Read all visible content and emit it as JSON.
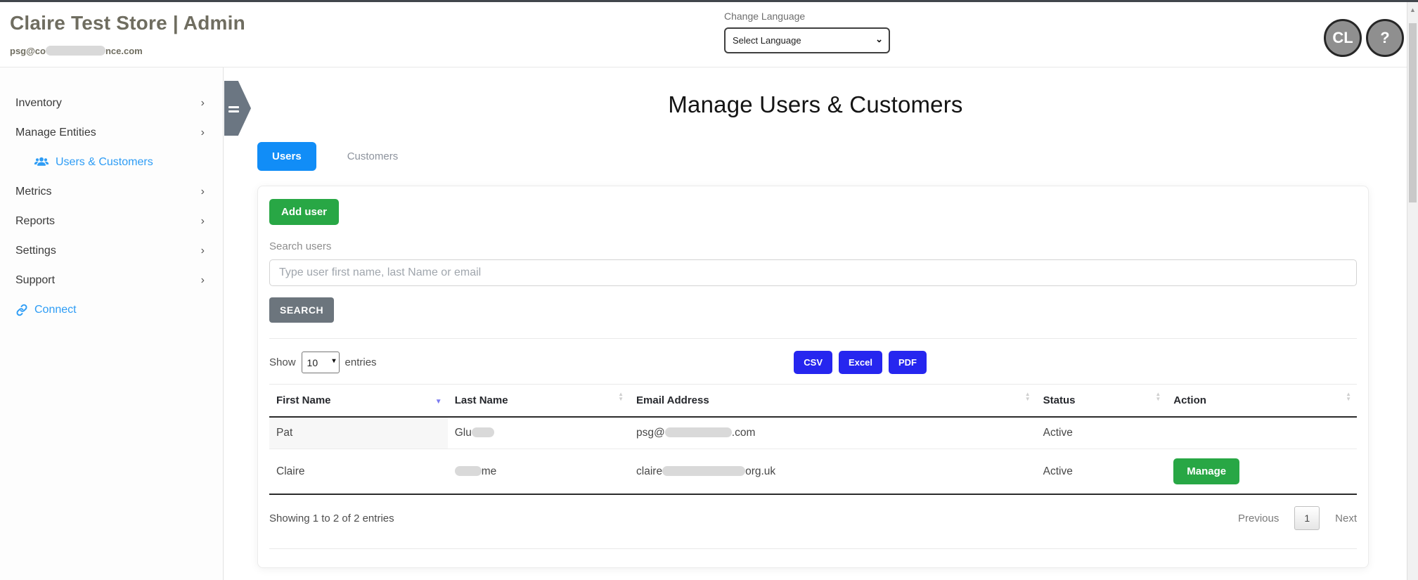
{
  "colors": {
    "accent_blue": "#118df7",
    "link_blue": "#2d9cf5",
    "export_blue": "#2626ef",
    "success_green": "#28a745",
    "secondary_gray": "#6c757d",
    "brand_text": "#6f6d60"
  },
  "header": {
    "brand": "Claire Test Store | Admin",
    "email_prefix": "psg@co",
    "email_suffix": "nce.com",
    "language_label": "Change Language",
    "language_value": "Select Language",
    "avatar_initials": "CL",
    "help": "?"
  },
  "sidebar": {
    "chevron": "›",
    "items": [
      {
        "label": "Inventory"
      },
      {
        "label": "Manage Entities"
      },
      {
        "label": "Users & Customers"
      },
      {
        "label": "Metrics"
      },
      {
        "label": "Reports"
      },
      {
        "label": "Settings"
      },
      {
        "label": "Support"
      },
      {
        "label": "Connect"
      }
    ]
  },
  "main": {
    "title": "Manage Users & Customers",
    "tabs": {
      "users": "Users",
      "customers": "Customers"
    },
    "add_user_label": "Add user",
    "search": {
      "label": "Search users",
      "placeholder": "Type user first name, last Name or email",
      "button": "SEARCH"
    },
    "controls": {
      "show_label": "Show",
      "page_size": "10",
      "entries_label": "entries",
      "export_buttons": [
        "CSV",
        "Excel",
        "PDF"
      ]
    },
    "table": {
      "columns": [
        "First Name",
        "Last Name",
        "Email Address",
        "Status",
        "Action"
      ],
      "rows": [
        {
          "first_name": "Pat",
          "last_name_prefix": "Glu",
          "last_name_suffix": "",
          "email_prefix": "psg@",
          "email_suffix": ".com",
          "status": "Active",
          "action": ""
        },
        {
          "first_name": "Claire",
          "last_name_prefix": "",
          "last_name_suffix": "me",
          "email_prefix": "claire",
          "email_suffix": "org.uk",
          "status": "Active",
          "action": "Manage"
        }
      ]
    },
    "pagination": {
      "info": "Showing 1 to 2 of 2 entries",
      "previous": "Previous",
      "page": "1",
      "next": "Next"
    }
  }
}
